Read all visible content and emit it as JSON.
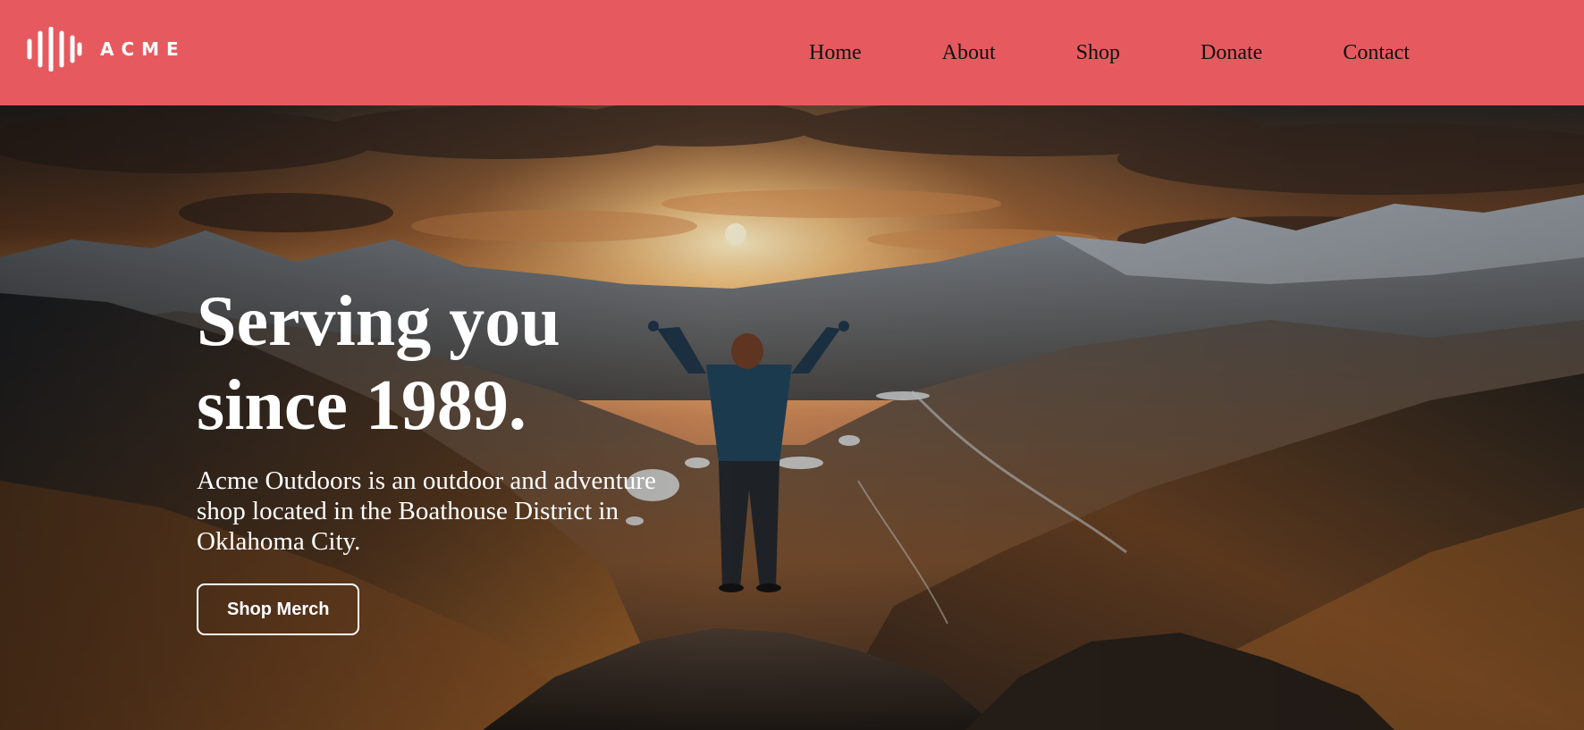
{
  "brand": {
    "name": "ACME",
    "logo_icon": "sound-wave-bars-icon",
    "header_color": "#e65a5f"
  },
  "nav": {
    "items": [
      {
        "label": "Home"
      },
      {
        "label": "About"
      },
      {
        "label": "Shop"
      },
      {
        "label": "Donate"
      },
      {
        "label": "Contact"
      }
    ]
  },
  "hero": {
    "title": "Serving you since 1989.",
    "description": "Acme Outdoors is an outdoor and adventure shop located in the Boathouse District in Oklahoma City.",
    "button_label": "Shop Merch",
    "background_image": "hiker-on-mountain-summit-at-sunset"
  }
}
